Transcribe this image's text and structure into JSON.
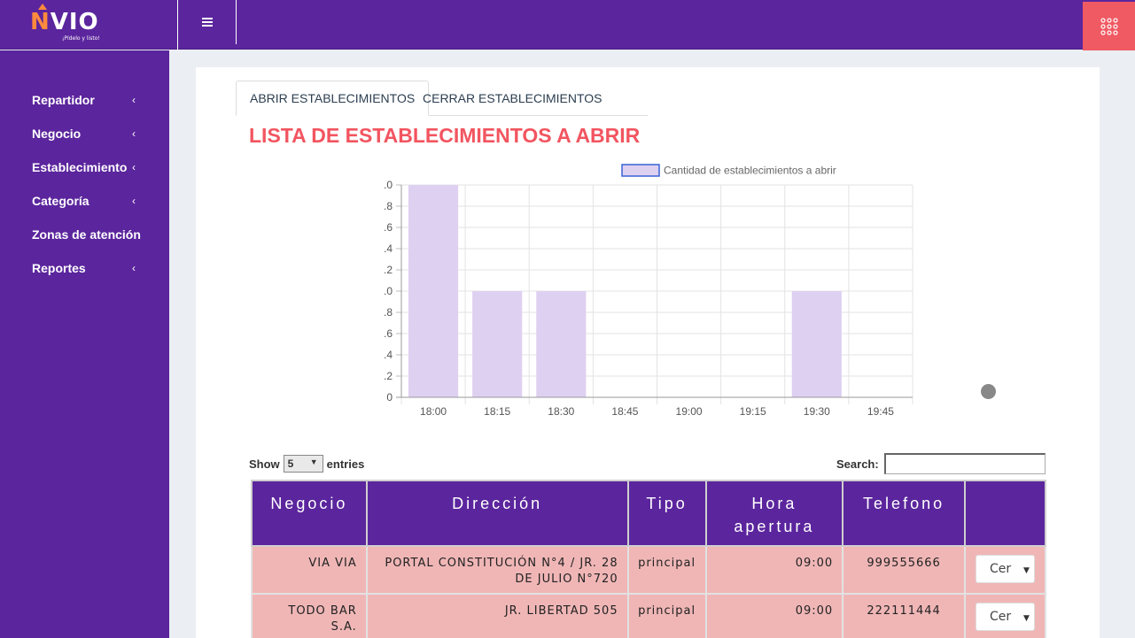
{
  "header": {
    "logo_name": "VIO",
    "logo_initial": "N",
    "logo_tagline": "¡Pídelo y listo!",
    "brand_color": "#5b259d",
    "apps_button_color": "#f05a63"
  },
  "sidebar": {
    "items": [
      {
        "label": "Repartidor",
        "has_submenu": true
      },
      {
        "label": "Negocio",
        "has_submenu": true
      },
      {
        "label": "Establecimiento",
        "has_submenu": true
      },
      {
        "label": "Categoría",
        "has_submenu": true
      },
      {
        "label": "Zonas de atención",
        "has_submenu": false
      },
      {
        "label": "Reportes",
        "has_submenu": true
      }
    ],
    "chevron": "‹"
  },
  "tabs": [
    {
      "label": "ABRIR ESTABLECIMIENTOS",
      "active": true
    },
    {
      "label": "CERRAR ESTABLECIMIENTOS",
      "active": false
    }
  ],
  "section_title": "LISTA DE ESTABLECIMIENTOS A ABRIR",
  "chart_data": {
    "type": "bar",
    "categories": [
      "18:00",
      "18:15",
      "18:30",
      "18:45",
      "19:00",
      "19:15",
      "19:30",
      "19:45"
    ],
    "series": [
      {
        "name": "Cantidad de establecimientos a abrir",
        "values": [
          2,
          1,
          1,
          0,
          0,
          0,
          1,
          0
        ],
        "color": "#ddd0f0",
        "border_color": "#3a62d6"
      }
    ],
    "y_tick_labels": [
      ".0",
      ".8",
      ".6",
      ".4",
      ".2",
      ".0",
      ".8",
      ".6",
      ".4",
      ".2",
      "0"
    ],
    "ylim": [
      0,
      2
    ],
    "grid": true,
    "legend": "top"
  },
  "table_controls": {
    "show_label": "Show",
    "entries_label": "entries",
    "page_size": "5",
    "search_label": "Search:",
    "search_value": ""
  },
  "table": {
    "headers": [
      "Negocio",
      "Dirección",
      "Tipo",
      "Hora apertura",
      "Telefono",
      ""
    ],
    "rows": [
      {
        "negocio": "VIA VIA",
        "direccion": "PORTAL CONSTITUCIÓN N°4 / JR. 28 DE JULIO N°720",
        "tipo": "principal",
        "hora": "09:00",
        "telefono": "999555666",
        "accion": "Cer"
      },
      {
        "negocio": "TODO BAR S.A.",
        "direccion": "JR. LIBERTAD 505",
        "tipo": "principal",
        "hora": "09:00",
        "telefono": "222111444",
        "accion": "Cer"
      }
    ],
    "header_color": "#5b259d",
    "row_color": "#f0b6b6"
  }
}
